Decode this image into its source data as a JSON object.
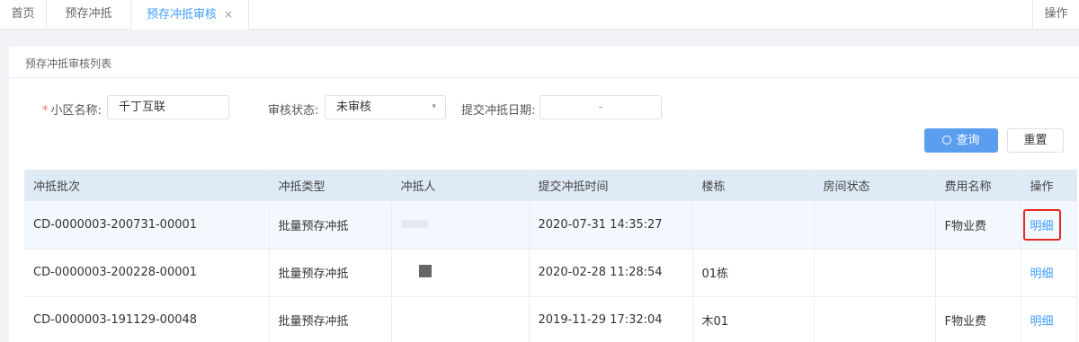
{
  "tabs": {
    "home": "首页",
    "prepay": "预存冲抵",
    "active": "预存冲抵审核",
    "close": "×",
    "ops": "操作"
  },
  "panel": {
    "title": "预存冲抵审核列表"
  },
  "form": {
    "community_label": "小区名称:",
    "community_required": "*",
    "community_value": "千丁互联",
    "status_label": "审核状态:",
    "status_value": "未审核",
    "date_label": "提交冲抵日期:",
    "date_separator": "-"
  },
  "buttons": {
    "search": "查询",
    "reset": "重置"
  },
  "table": {
    "headers": [
      "冲抵批次",
      "冲抵类型",
      "冲抵人",
      "提交冲抵时间",
      "楼栋",
      "房间状态",
      "费用名称",
      "操作"
    ],
    "rows": [
      {
        "batch": "CD-0000003-200731-00001",
        "type": "批量预存冲抵",
        "time": "2020-07-31 14:35:27",
        "building": "",
        "room_status": "",
        "fee": "F物业费",
        "action": "明细"
      },
      {
        "batch": "CD-0000003-200228-00001",
        "type": "批量预存冲抵",
        "time": "2020-02-28 11:28:54",
        "building": "01栋",
        "room_status": "",
        "fee": "",
        "action": "明细"
      },
      {
        "batch": "CD-0000003-191129-00048",
        "type": "批量预存冲抵",
        "time": "2019-11-29 17:32:04",
        "building": "木01",
        "room_status": "",
        "fee": "F物业费",
        "action": "明细"
      }
    ]
  },
  "colors": {
    "accent": "#409eff",
    "primary_button": "#5b9ef0",
    "header_bg": "#dfeaf7",
    "highlight_border": "#e2291e"
  }
}
